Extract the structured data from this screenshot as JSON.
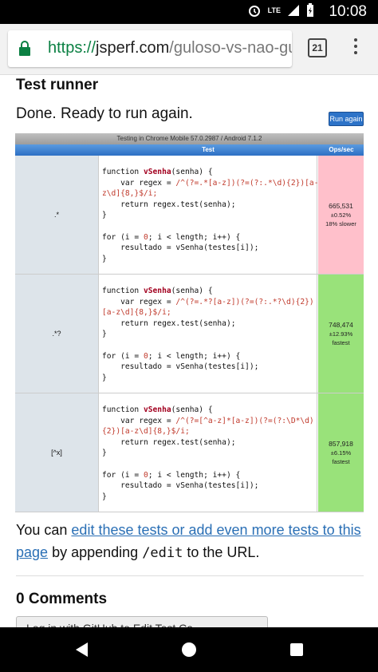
{
  "status_bar": {
    "time": "10:08",
    "network": "LTE"
  },
  "browser": {
    "url_scheme": "https://",
    "url_host": "jsperf.com",
    "url_path": "/guloso-vs-nao-gulo",
    "tab_count": "21"
  },
  "page": {
    "section_title": "Test runner",
    "status_text": "Done. Ready to run again.",
    "run_button": "Run again",
    "table": {
      "title": "Testing in Chrome Mobile 57.0.2987 / Android 7.1.2",
      "col_test": "Test",
      "col_ops": "Ops/sec",
      "rows": [
        {
          "name": ".*",
          "code_lines": [
            "function vSenha(senha) {",
            "    var regex = /^(?=.*[a-z])(?=(?:.*\\d){2})[a-",
            "z\\d]{8,}$/i;",
            "    return regex.test(senha);",
            "}",
            "",
            "for (i = 0; i < length; i++) {",
            "    resultado = vSenha(testes[i]);",
            "}"
          ],
          "ops": "665,531",
          "error": "±0.52%",
          "note": "18% slower",
          "status": "slow"
        },
        {
          "name": ".*?",
          "code_lines": [
            "function vSenha(senha) {",
            "    var regex = /^(?=.*?[a-z])(?=(?:.*?\\d){2})",
            "[a-z\\d]{8,}$/i;",
            "    return regex.test(senha);",
            "}",
            "",
            "for (i = 0; i < length; i++) {",
            "    resultado = vSenha(testes[i]);",
            "}"
          ],
          "ops": "748,474",
          "error": "±12.93%",
          "note": "fastest",
          "status": "fast"
        },
        {
          "name": "[^x]",
          "code_lines": [
            "function vSenha(senha) {",
            "    var regex = /^(?=[^a-z]*[a-z])(?=(?:\\D*\\d)",
            "{2})[a-z\\d]{8,}$/i;",
            "    return regex.test(senha);",
            "}",
            "",
            "for (i = 0; i < length; i++) {",
            "    resultado = vSenha(testes[i]);",
            "}"
          ],
          "ops": "857,918",
          "error": "±6.15%",
          "note": "fastest",
          "status": "fast"
        }
      ]
    },
    "footer": {
      "you_can": "You can",
      "link_text": "edit these tests or add even more tests to this page",
      "by_appending": "by appending",
      "edit_code": "/edit",
      "to_url": "to the URL."
    },
    "comments_title": "0 Comments",
    "login_button": "Log in with GitHub to Edit Test Ca..."
  }
}
